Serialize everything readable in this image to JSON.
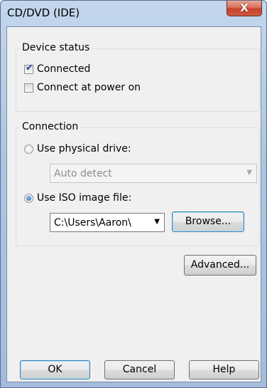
{
  "window": {
    "title": "CD/DVD (IDE)",
    "close_label": "X"
  },
  "device_status": {
    "group_label": "Device status",
    "connected": {
      "label": "Connected",
      "checked": true
    },
    "connect_at_power_on": {
      "label": "Connect at power on",
      "checked": false
    }
  },
  "connection": {
    "group_label": "Connection",
    "use_physical_drive": {
      "label": "Use physical drive:",
      "selected": false
    },
    "physical_drive_select": {
      "value": "Auto detect",
      "enabled": false
    },
    "use_iso_image": {
      "label": "Use ISO image file:",
      "selected": true
    },
    "iso_path_select": {
      "value": "C:\\Users\\Aaron\\"
    },
    "browse_label": "Browse..."
  },
  "advanced_label": "Advanced...",
  "footer": {
    "ok_label": "OK",
    "cancel_label": "Cancel",
    "help_label": "Help"
  },
  "icons": {
    "check_mark": "✔",
    "dropdown_arrow": "▼"
  }
}
